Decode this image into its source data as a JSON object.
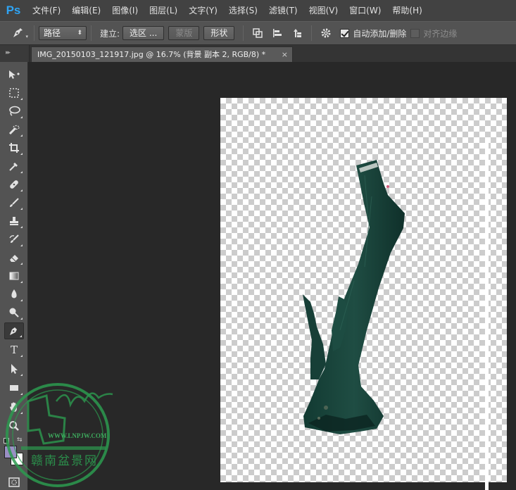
{
  "app": {
    "logo": "Ps",
    "brand_color": "#2fa4f4"
  },
  "menu": [
    "文件(F)",
    "编辑(E)",
    "图像(I)",
    "图层(L)",
    "文字(Y)",
    "选择(S)",
    "滤镜(T)",
    "视图(V)",
    "窗口(W)",
    "帮助(H)"
  ],
  "options": {
    "tool_icon": "pen-tool-icon",
    "mode_select": "路径",
    "build_label": "建立:",
    "selection_button": "选区 ...",
    "mask_button": "蒙版",
    "shape_button": "形状",
    "auto_add_delete_checked": true,
    "auto_add_delete_label": "自动添加/删除",
    "align_edges_checked": false,
    "align_edges_label": "对齐边缘"
  },
  "document_tab": {
    "title": "IMG_20150103_121917.jpg @ 16.7% (背景 副本 2, RGB/8) *",
    "close": "×"
  },
  "tools": [
    "move-tool-icon",
    "marquee-tool-icon",
    "lasso-tool-icon",
    "quick-selection-tool-icon",
    "crop-tool-icon",
    "eyedropper-tool-icon",
    "healing-brush-tool-icon",
    "brush-tool-icon",
    "clone-stamp-tool-icon",
    "history-brush-tool-icon",
    "eraser-tool-icon",
    "gradient-tool-icon",
    "blur-tool-icon",
    "dodge-tool-icon",
    "pen-tool-icon",
    "type-tool-icon",
    "path-selection-tool-icon",
    "rectangle-tool-icon",
    "hand-tool-icon",
    "zoom-tool-icon"
  ],
  "type_tool_glyph": "T",
  "watermark": {
    "url": "WWW.LNPJW.COM",
    "text": "赣南盆景网"
  }
}
